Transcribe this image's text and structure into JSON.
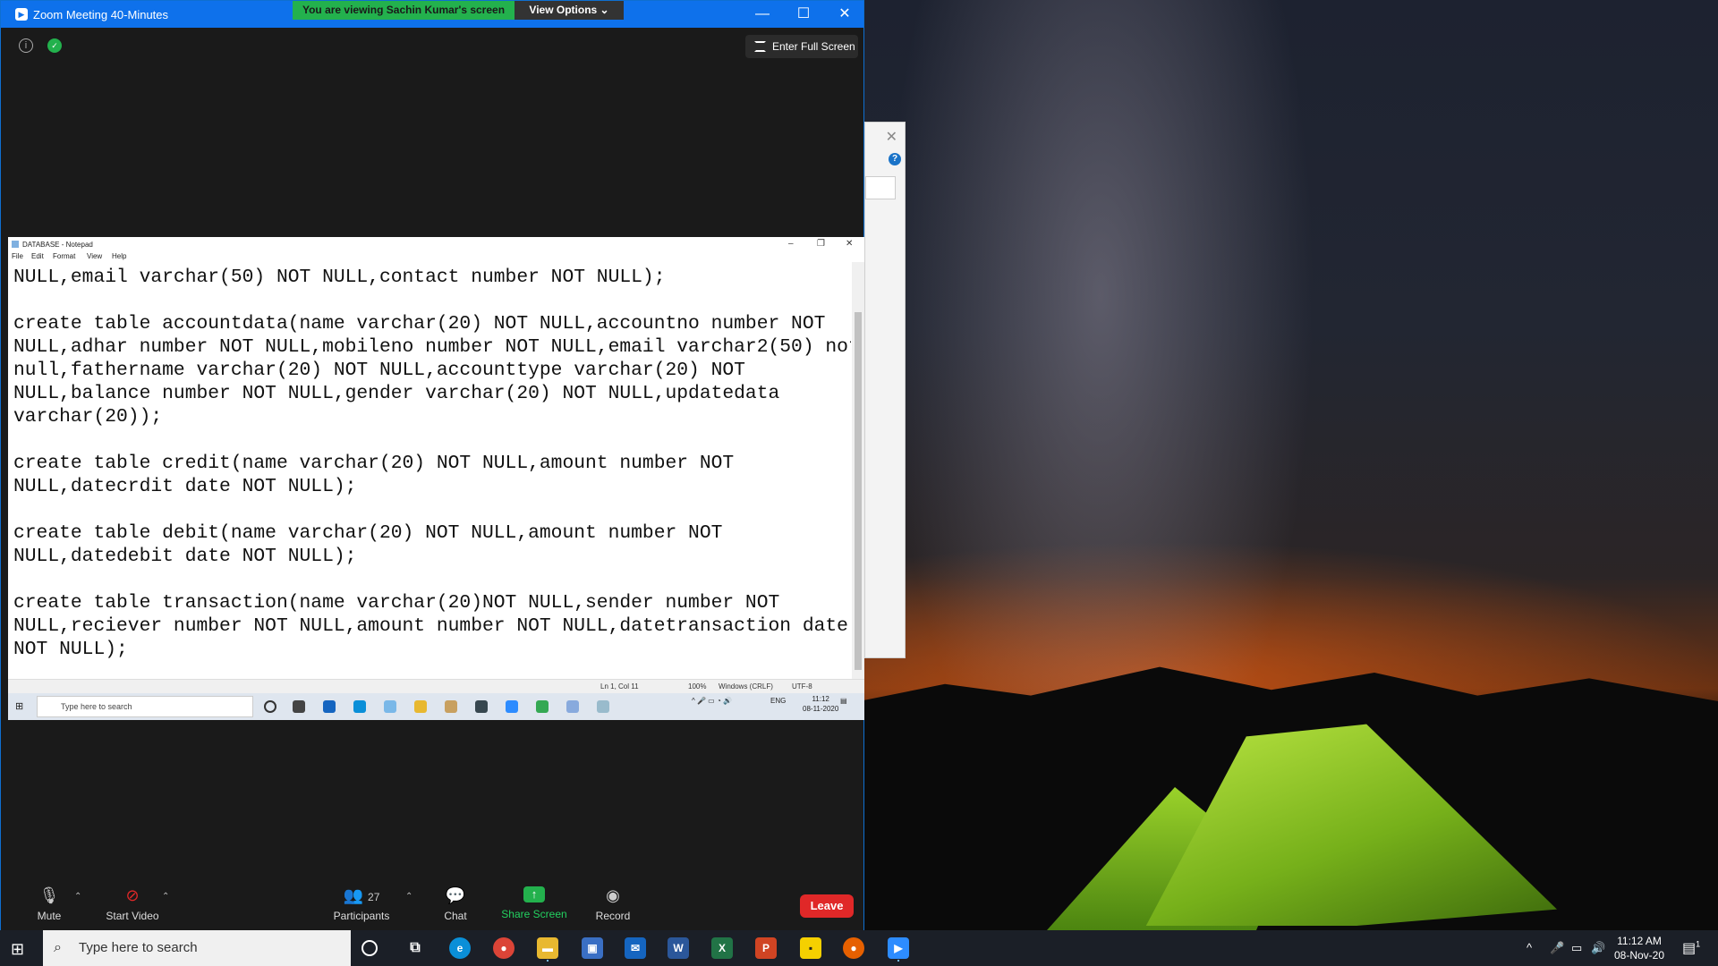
{
  "zoom": {
    "window_title": "Zoom Meeting 40-Minutes",
    "sharing_banner": "You are viewing Sachin Kumar's screen",
    "view_options": "View Options ⌄",
    "fullscreen_label": "Enter Full Screen",
    "toolbar": {
      "mute": "Mute",
      "start_video": "Start Video",
      "participants": "Participants",
      "participants_count": "27",
      "chat": "Chat",
      "share_screen": "Share Screen",
      "record": "Record",
      "leave": "Leave"
    },
    "colors": {
      "title_bar": "#0e71eb",
      "banner": "#23b14d",
      "leave": "#e02828"
    }
  },
  "notepad": {
    "title": "DATABASE - Notepad",
    "menu": [
      "File",
      "Edit",
      "Format",
      "View",
      "Help"
    ],
    "content": "NULL,email varchar(50) NOT NULL,contact number NOT NULL);\n\ncreate table accountdata(name varchar(20) NOT NULL,accountno number NOT\nNULL,adhar number NOT NULL,mobileno number NOT NULL,email varchar2(50) not\nnull,fathername varchar(20) NOT NULL,accounttype varchar(20) NOT\nNULL,balance number NOT NULL,gender varchar(20) NOT NULL,updatedata\nvarchar(20));\n\ncreate table credit(name varchar(20) NOT NULL,amount number NOT\nNULL,datecrdit date NOT NULL);\n\ncreate table debit(name varchar(20) NOT NULL,amount number NOT\nNULL,datedebit date NOT NULL);\n\ncreate table transaction(name varchar(20)NOT NULL,sender number NOT\nNULL,reciever number NOT NULL,amount number NOT NULL,datetransaction date\nNOT NULL);",
    "status": {
      "position": "Ln 1, Col 11",
      "zoom": "100%",
      "line_ending": "Windows (CRLF)",
      "encoding": "UTF-8"
    }
  },
  "inner_taskbar": {
    "search_placeholder": "Type here to search",
    "lang": "ENG",
    "time": "11:12",
    "date": "08-11-2020"
  },
  "taskbar": {
    "search_placeholder": "Type here to search",
    "time": "11:12 AM",
    "date": "08-Nov-20",
    "notification_count": "1"
  }
}
